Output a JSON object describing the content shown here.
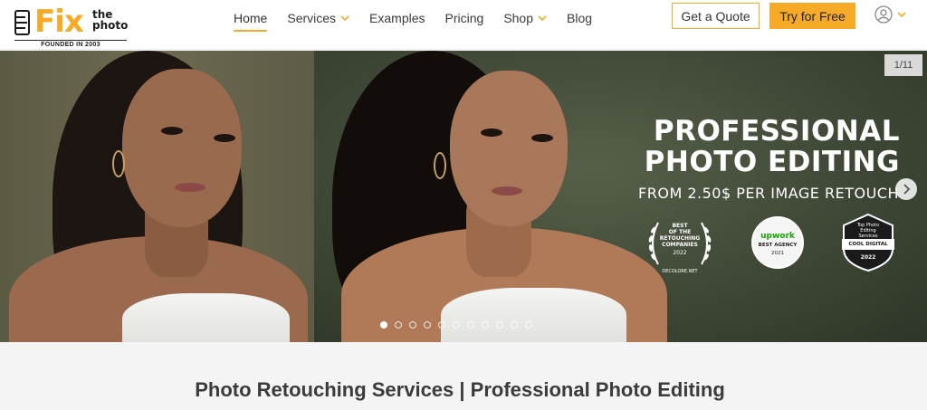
{
  "logo": {
    "fix": "Fix",
    "the": "the",
    "photo": "photo",
    "founded": "FOUNDED IN 2003"
  },
  "nav": {
    "items": [
      {
        "label": "Home",
        "active": true,
        "has_dropdown": false
      },
      {
        "label": "Services",
        "active": false,
        "has_dropdown": true
      },
      {
        "label": "Examples",
        "active": false,
        "has_dropdown": false
      },
      {
        "label": "Pricing",
        "active": false,
        "has_dropdown": false
      },
      {
        "label": "Shop",
        "active": false,
        "has_dropdown": true
      },
      {
        "label": "Blog",
        "active": false,
        "has_dropdown": false
      }
    ]
  },
  "header": {
    "quote_label": "Get a Quote",
    "try_label": "Try for Free",
    "account_icon": "user-circle-icon"
  },
  "hero": {
    "counter": "1/11",
    "title_line1": "PROFESSIONAL",
    "title_line2": "PHOTO EDITING",
    "subtitle": "FROM 2.50$ PER IMAGE RETOUCH",
    "total_slides": 11,
    "active_slide": 1,
    "badges": {
      "b1": {
        "line1": "BEST",
        "line2": "OF THE",
        "line3": "RETOUCHING",
        "line4": "COMPANIES",
        "year": "2022",
        "foot": "DECOLORE.NET"
      },
      "b2": {
        "brand": "upwork",
        "label": "BEST AGENCY",
        "year": "2021"
      },
      "b3": {
        "top": "Top Photo Editing Services",
        "ribbon": "COOL DIGITAL",
        "year": "2022"
      }
    }
  },
  "main": {
    "heading": "Photo Retouching Services | Professional Photo Editing"
  },
  "colors": {
    "accent": "#f7a928",
    "text": "#3a3a3a",
    "section_bg": "#f4f4f4"
  }
}
